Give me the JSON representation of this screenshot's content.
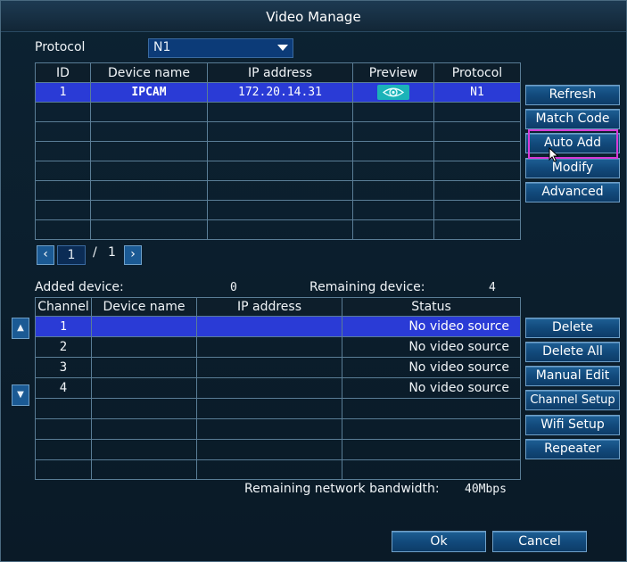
{
  "window": {
    "title": "Video Manage"
  },
  "protocol": {
    "label": "Protocol",
    "value": "N1"
  },
  "device_table": {
    "headers": [
      "ID",
      "Device name",
      "IP address",
      "Preview",
      "Protocol"
    ],
    "rows": [
      {
        "id": "1",
        "device_name": "IPCAM",
        "ip": "172.20.14.31",
        "preview": "eye-icon",
        "protocol": "N1"
      }
    ],
    "empty_rows": 7
  },
  "pagination": {
    "current": "1",
    "separator": "/",
    "total": "1"
  },
  "side_buttons_top": {
    "refresh": "Refresh",
    "match_code": "Match Code",
    "auto_add": "Auto Add",
    "modify": "Modify",
    "advanced": "Advanced"
  },
  "counts": {
    "added_label": "Added device:",
    "added_value": "0",
    "remaining_label": "Remaining device:",
    "remaining_value": "4"
  },
  "channel_table": {
    "headers": [
      "Channel",
      "Device name",
      "IP address",
      "Status"
    ],
    "rows": [
      {
        "channel": "1",
        "device_name": "",
        "ip": "",
        "status": "No video source"
      },
      {
        "channel": "2",
        "device_name": "",
        "ip": "",
        "status": "No video source"
      },
      {
        "channel": "3",
        "device_name": "",
        "ip": "",
        "status": "No video source"
      },
      {
        "channel": "4",
        "device_name": "",
        "ip": "",
        "status": "No video source"
      }
    ],
    "empty_rows": 4
  },
  "side_buttons_bottom": {
    "delete": "Delete",
    "delete_all": "Delete All",
    "manual_edit": "Manual Edit",
    "channel_setup": "Channel Setup",
    "wifi_setup": "Wifi Setup",
    "repeater": "Repeater"
  },
  "bandwidth": {
    "label": "Remaining network bandwidth:",
    "value": "40Mbps"
  },
  "footer": {
    "ok": "Ok",
    "cancel": "Cancel"
  },
  "icons": {
    "prev": "chevron-left-icon",
    "next": "chevron-right-icon",
    "up": "arrow-up-icon",
    "down": "arrow-down-icon"
  },
  "colors": {
    "selected_row": "#2a3bd6",
    "preview_accent": "#1bb3b8",
    "highlight": "#d63ad6",
    "button": "#124a7c"
  }
}
